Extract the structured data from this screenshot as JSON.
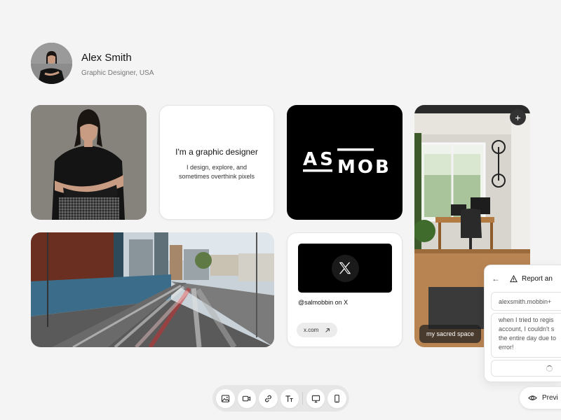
{
  "profile": {
    "name": "Alex Smith",
    "role": "Graphic Designer, USA"
  },
  "text_card": {
    "heading": "I'm a graphic designer",
    "body": "I design, explore, and sometimes overthink pixels"
  },
  "logo_card": {
    "line1": "AS",
    "line2": "MOB"
  },
  "x_card": {
    "handle": "@salmobbin on X",
    "link_label": "x.com"
  },
  "room_card": {
    "caption": "my sacred space",
    "add_label": "+"
  },
  "report_panel": {
    "title": "Report an",
    "email": "alexsmith.mobbin+",
    "message": "when I tried to regis\naccount, I couldn't s\nthe entire day due to\nerror!"
  },
  "toolbar": {
    "tools": [
      "image-icon",
      "video-icon",
      "link-icon",
      "text-icon",
      "desktop-icon",
      "mobile-icon"
    ]
  },
  "preview_button": {
    "label": "Previ"
  },
  "colors": {
    "background": "#f4f4f4",
    "card": "#ffffff",
    "logo_bg": "#000000",
    "toolbar": "#e6e6e6"
  }
}
